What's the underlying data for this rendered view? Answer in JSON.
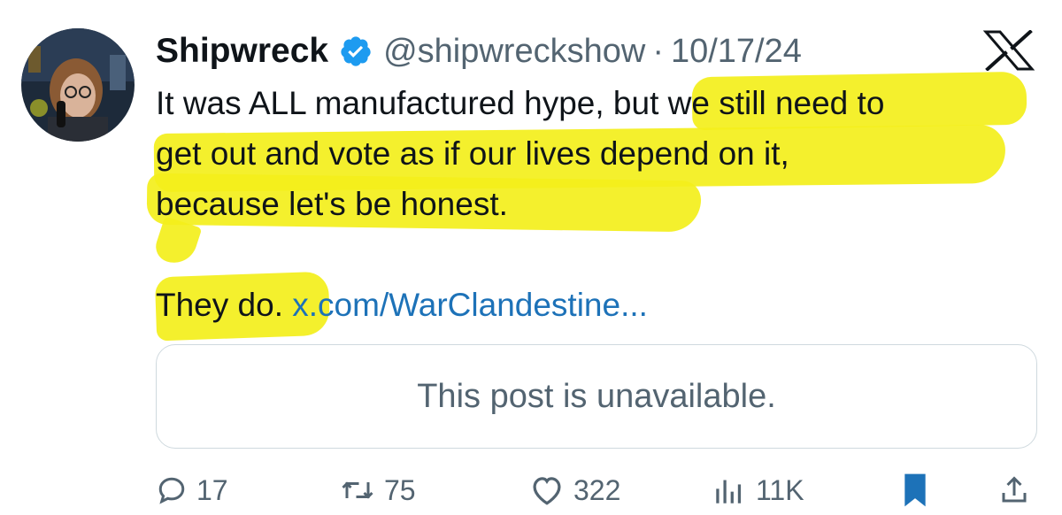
{
  "author": {
    "name": "Shipwreck",
    "handle": "@shipwreckshow",
    "separator": "·",
    "date": "10/17/24",
    "verified": true,
    "avatar_icon": "profile-photo"
  },
  "platform_icon": "x-logo-icon",
  "post": {
    "line_1_plain": "It was ALL manufactured hype,",
    "line_1_highlighted": " but we still need to",
    "line_2": "get out and vote as if our lives depend on it,",
    "line_3": "because let's be honest.",
    "para_2_text": "They do. ",
    "link_text": "x.com/WarClandestine..."
  },
  "quoted_post": {
    "message": "This post is unavailable."
  },
  "actions": {
    "reply_count": "17",
    "retweet_count": "75",
    "like_count": "322",
    "view_count": "11K"
  },
  "colors": {
    "highlight": "#f3ef1b",
    "verified_badge": "#1d9bf0",
    "link": "#1d72b8",
    "bookmark_active": "#1d72b8",
    "secondary_text": "#536471"
  }
}
